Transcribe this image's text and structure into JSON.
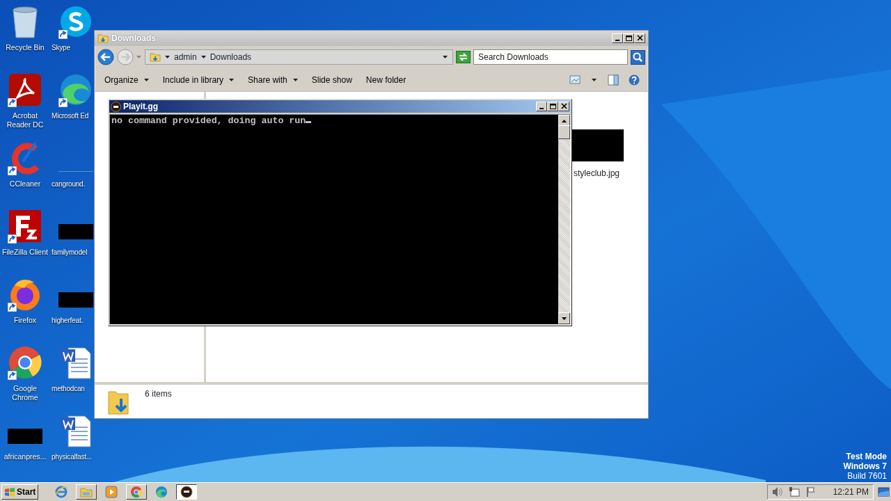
{
  "desktop": {
    "icons": [
      {
        "label": "Recycle Bin",
        "kind": "recycle",
        "shortcut": false
      },
      {
        "label": "Acrobat Reader DC",
        "kind": "acrobat",
        "shortcut": true
      },
      {
        "label": "CCleaner",
        "kind": "ccleaner",
        "shortcut": true
      },
      {
        "label": "FileZilla Client",
        "kind": "filezilla",
        "shortcut": true
      },
      {
        "label": "Firefox",
        "kind": "firefox",
        "shortcut": true
      },
      {
        "label": "Google Chrome",
        "kind": "chrome",
        "shortcut": true
      },
      {
        "label": "africanpres...",
        "kind": "redacted",
        "shortcut": false
      },
      {
        "label": "Skype",
        "kind": "skype",
        "shortcut": true
      },
      {
        "label": "Microsoft Ed",
        "kind": "edge",
        "shortcut": true
      },
      {
        "label": "canground.",
        "kind": "blank",
        "shortcut": false
      },
      {
        "label": "familymodel",
        "kind": "redacted",
        "shortcut": false
      },
      {
        "label": "higherfeat.",
        "kind": "redacted",
        "shortcut": false
      },
      {
        "label": "methodcan",
        "kind": "word",
        "shortcut": false
      },
      {
        "label": "physicalfast...",
        "kind": "word",
        "shortcut": false
      }
    ],
    "watermark_lines": [
      "Test Mode",
      "Windows 7",
      "Build 7601"
    ]
  },
  "explorer": {
    "title": "Downloads",
    "breadcrumb": [
      "admin",
      "Downloads"
    ],
    "search": {
      "placeholder": "Search Downloads"
    },
    "toolbar": [
      {
        "label": "Organize",
        "dropdown": true
      },
      {
        "label": "Include in library",
        "dropdown": true
      },
      {
        "label": "Share with",
        "dropdown": true
      },
      {
        "label": "Slide show",
        "dropdown": false
      },
      {
        "label": "New folder",
        "dropdown": false
      }
    ],
    "files": [
      {
        "name": "styleclub.jpg"
      }
    ],
    "status": "6 items"
  },
  "console": {
    "title": "Playit.gg",
    "lines": [
      "no command provided, doing auto run"
    ]
  },
  "taskbar": {
    "start": "Start",
    "apps": [
      {
        "kind": "ie",
        "running": false,
        "selected": false
      },
      {
        "kind": "explorer",
        "running": true,
        "selected": false
      },
      {
        "kind": "media",
        "running": false,
        "selected": false
      },
      {
        "kind": "chrome",
        "running": true,
        "selected": false
      },
      {
        "kind": "edge",
        "running": false,
        "selected": false
      },
      {
        "kind": "playit",
        "running": true,
        "selected": true
      }
    ],
    "clock": "12:21 PM"
  }
}
